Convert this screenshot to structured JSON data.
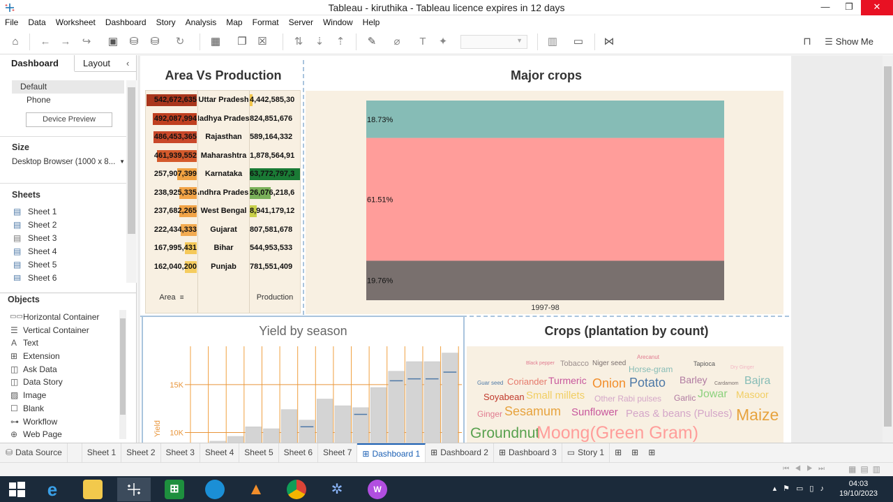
{
  "window": {
    "title": "Tableau - kiruthika - Tableau licence expires in 12 days",
    "minimize": "—",
    "maximize": "❐",
    "close": "✕"
  },
  "menu": [
    "File",
    "Data",
    "Worksheet",
    "Dashboard",
    "Story",
    "Analysis",
    "Map",
    "Format",
    "Server",
    "Window",
    "Help"
  ],
  "toolbar": {
    "show_me": "Show Me"
  },
  "left_panel": {
    "tabs": [
      "Dashboard",
      "Layout"
    ],
    "device": {
      "default": "Default",
      "phone": "Phone",
      "preview_button": "Device Preview"
    },
    "size": {
      "heading": "Size",
      "value": "Desktop Browser (1000 x 8..."
    },
    "sheets": {
      "heading": "Sheets",
      "items": [
        "Sheet 1",
        "Sheet 2",
        "Sheet 3",
        "Sheet 4",
        "Sheet 5",
        "Sheet 6"
      ]
    },
    "objects": {
      "heading": "Objects",
      "items": [
        "Horizontal Container",
        "Vertical Container",
        "Text",
        "Extension",
        "Ask Data",
        "Data Story",
        "Image",
        "Blank",
        "Workflow",
        "Web Page"
      ]
    }
  },
  "area_vs_production": {
    "title": "Area Vs Production",
    "col_area": "Area",
    "col_production": "Production",
    "rows": [
      {
        "area": "542,672,635",
        "state": "Uttar Pradesh",
        "production": "4,442,585,30",
        "area_color": "#a9361c",
        "prod_color": "#f3c74d",
        "area_frac": 1.0,
        "prod_frac": 0.06
      },
      {
        "area": "492,087,994",
        "state": "Madhya Pradesh",
        "production": "824,851,676",
        "area_color": "#bf3f1f",
        "prod_color": "",
        "area_frac": 0.87,
        "prod_frac": 0
      },
      {
        "area": "486,453,365",
        "state": "Rajasthan",
        "production": "589,164,332",
        "area_color": "#c9482a",
        "prod_color": "",
        "area_frac": 0.86,
        "prod_frac": 0
      },
      {
        "area": "461,939,552",
        "state": "Maharashtra",
        "production": "1,878,564,91",
        "area_color": "#d45a2c",
        "prod_color": "",
        "area_frac": 0.79,
        "prod_frac": 0
      },
      {
        "area": "257,907,399",
        "state": "Karnataka",
        "production": "63,772,797,3",
        "area_color": "#f0a242",
        "prod_color": "#1a7a35",
        "area_frac": 0.39,
        "prod_frac": 1.0
      },
      {
        "area": "238,925,335",
        "state": "Andhra Pradesh",
        "production": "26,076,218,6",
        "area_color": "#f2a447",
        "prod_color": "#7bb15a",
        "area_frac": 0.35,
        "prod_frac": 0.41
      },
      {
        "area": "237,682,265",
        "state": "West Bengal",
        "production": "8,941,179,12",
        "area_color": "#f2a447",
        "prod_color": "#c9d04a",
        "area_frac": 0.35,
        "prod_frac": 0.14
      },
      {
        "area": "222,434,333",
        "state": "Gujarat",
        "production": "807,581,678",
        "area_color": "#f3ab50",
        "prod_color": "",
        "area_frac": 0.32,
        "prod_frac": 0
      },
      {
        "area": "167,995,431",
        "state": "Bihar",
        "production": "544,953,533",
        "area_color": "#f5c95a",
        "prod_color": "",
        "area_frac": 0.24,
        "prod_frac": 0
      },
      {
        "area": "162,040,200",
        "state": "Punjab",
        "production": "781,551,409",
        "area_color": "#f5cc5f",
        "prod_color": "",
        "area_frac": 0.23,
        "prod_frac": 0
      }
    ]
  },
  "major_crops": {
    "title": "Major crops",
    "chart_data": {
      "type": "bar",
      "stacked": true,
      "categories": [
        "1997-98"
      ],
      "series": [
        {
          "label": "18.73%",
          "value": 18.73,
          "color": "#86bcb6"
        },
        {
          "label": "61.51%",
          "value": 61.51,
          "color": "#ff9d9a"
        },
        {
          "label": "19.76%",
          "value": 19.76,
          "color": "#79706e"
        }
      ]
    }
  },
  "yield_by_season": {
    "title": "Yield by season",
    "y_ticks": [
      "15K",
      "10K"
    ],
    "y_label": "Yield",
    "chart_data": {
      "type": "bar",
      "visible_range": [
        8800,
        19000
      ],
      "values": [
        9100,
        9600,
        10600,
        10400,
        12400,
        11300,
        13500,
        12800,
        12600,
        14700,
        16400,
        17400,
        17400,
        18300
      ],
      "ref_lines": [
        null,
        null,
        null,
        null,
        null,
        10600,
        null,
        null,
        11900,
        null,
        15400,
        15600,
        15600,
        16300
      ]
    }
  },
  "crops_plantation": {
    "title": "Crops (plantation by count)",
    "words": [
      {
        "t": "Black pepper",
        "c": "#e07a8f"
      },
      {
        "t": "Tobacco",
        "c": "#9b8e8c"
      },
      {
        "t": "Niger seed",
        "c": "#7a6f6d"
      },
      {
        "t": "Arecanut",
        "c": "#e07a8f"
      },
      {
        "t": "Tapioca",
        "c": "#5a5a5a"
      },
      {
        "t": "Dry Ginger",
        "c": "#f3b7c4"
      },
      {
        "t": "Horse-gram",
        "c": "#86bcb6"
      },
      {
        "t": "Guar seed",
        "c": "#4e79a7"
      },
      {
        "t": "Coriander",
        "c": "#e5796b"
      },
      {
        "t": "Turmeric",
        "c": "#c7579c"
      },
      {
        "t": "Onion",
        "c": "#f28e2b"
      },
      {
        "t": "Potato",
        "c": "#4e79a7"
      },
      {
        "t": "Barley",
        "c": "#b07aa1"
      },
      {
        "t": "Cardamom",
        "c": "#7a6f6d"
      },
      {
        "t": "Bajra",
        "c": "#86bcb6"
      },
      {
        "t": "Soyabean",
        "c": "#c0392b"
      },
      {
        "t": "Small millets",
        "c": "#f1ce63"
      },
      {
        "t": "Other Rabi pulses",
        "c": "#d4a6c8"
      },
      {
        "t": "Garlic",
        "c": "#b07aa1"
      },
      {
        "t": "Jowar",
        "c": "#8cd17d"
      },
      {
        "t": "Masoor",
        "c": "#f1ce63"
      },
      {
        "t": "Ginger",
        "c": "#e07a8f"
      },
      {
        "t": "Sesamum",
        "c": "#e7a33e"
      },
      {
        "t": "Sunflower",
        "c": "#c7579c"
      },
      {
        "t": "Peas & beans (Pulses)",
        "c": "#d4a6c8"
      },
      {
        "t": "Maize",
        "c": "#e7a33e"
      },
      {
        "t": "Groundnut",
        "c": "#59a14f"
      },
      {
        "t": "Moong(Green Gram)",
        "c": "#ff9d9a"
      }
    ]
  },
  "sheet_tabs": [
    "Data Source",
    "Sheet 1",
    "Sheet 2",
    "Sheet 3",
    "Sheet 4",
    "Sheet 5",
    "Sheet 6",
    "Sheet 7",
    "Dashboard 1",
    "Dashboard 2",
    "Dashboard 3",
    "Story 1"
  ],
  "active_tab": "Dashboard 1",
  "clock": {
    "time": "04:03",
    "date": "19/10/2023"
  }
}
